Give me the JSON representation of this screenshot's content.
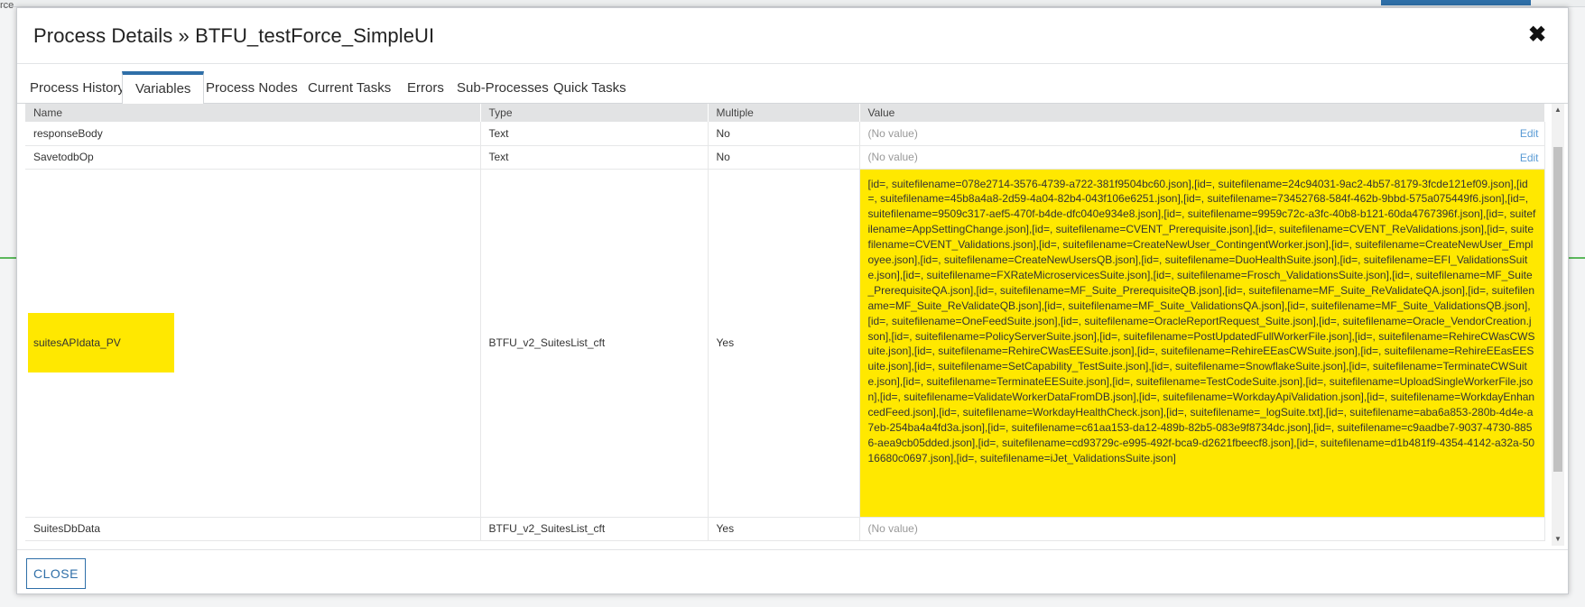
{
  "background": {
    "corner_label": "rce"
  },
  "modal": {
    "title": "Process Details » BTFU_testForce_SimpleUI",
    "close_icon": "close-icon",
    "close_glyph": "✖"
  },
  "tabs": [
    {
      "label": "Process History",
      "active": false
    },
    {
      "label": "Variables",
      "active": true
    },
    {
      "label": "Process Nodes",
      "active": false
    },
    {
      "label": "Current Tasks",
      "active": false
    },
    {
      "label": "Errors",
      "active": false
    },
    {
      "label": "Sub-Processes",
      "active": false
    },
    {
      "label": "Quick Tasks",
      "active": false
    }
  ],
  "table": {
    "headers": {
      "name": "Name",
      "type": "Type",
      "multiple": "Multiple",
      "value": "Value"
    },
    "rows": [
      {
        "name": "responseBody",
        "type": "Text",
        "multiple": "No",
        "value": "(No value)",
        "edit": "Edit"
      },
      {
        "name": "SavetodbOp",
        "type": "Text",
        "multiple": "No",
        "value": "(No value)",
        "edit": "Edit"
      },
      {
        "name": "suitesAPIdata_PV",
        "type": "BTFU_v2_SuitesList_cft",
        "multiple": "Yes",
        "value": "[id=, suitefilename=078e2714-3576-4739-a722-381f9504bc60.json],[id=, suitefilename=24c94031-9ac2-4b57-8179-3fcde121ef09.json],[id=, suitefilename=45b8a4a8-2d59-4a04-82b4-043f106e6251.json],[id=, suitefilename=73452768-584f-462b-9bbd-575a075449f6.json],[id=, suitefilename=9509c317-aef5-470f-b4de-dfc040e934e8.json],[id=, suitefilename=9959c72c-a3fc-40b8-b121-60da4767396f.json],[id=, suitefilename=AppSettingChange.json],[id=, suitefilename=CVENT_Prerequisite.json],[id=, suitefilename=CVENT_ReValidations.json],[id=, suitefilename=CVENT_Validations.json],[id=, suitefilename=CreateNewUser_ContingentWorker.json],[id=, suitefilename=CreateNewUser_Employee.json],[id=, suitefilename=CreateNewUsersQB.json],[id=, suitefilename=DuoHealthSuite.json],[id=, suitefilename=EFI_ValidationsSuite.json],[id=, suitefilename=FXRateMicroservicesSuite.json],[id=, suitefilename=Frosch_ValidationsSuite.json],[id=, suitefilename=MF_Suite_PrerequisiteQA.json],[id=, suitefilename=MF_Suite_PrerequisiteQB.json],[id=, suitefilename=MF_Suite_ReValidateQA.json],[id=, suitefilename=MF_Suite_ReValidateQB.json],[id=, suitefilename=MF_Suite_ValidationsQA.json],[id=, suitefilename=MF_Suite_ValidationsQB.json],[id=, suitefilename=OneFeedSuite.json],[id=, suitefilename=OracleReportRequest_Suite.json],[id=, suitefilename=Oracle_VendorCreation.json],[id=, suitefilename=PolicyServerSuite.json],[id=, suitefilename=PostUpdatedFullWorkerFile.json],[id=, suitefilename=RehireCWasCWSuite.json],[id=, suitefilename=RehireCWasEESuite.json],[id=, suitefilename=RehireEEasCWSuite.json],[id=, suitefilename=RehireEEasEESuite.json],[id=, suitefilename=SetCapability_TestSuite.json],[id=, suitefilename=SnowflakeSuite.json],[id=, suitefilename=TerminateCWSuite.json],[id=, suitefilename=TerminateEESuite.json],[id=, suitefilename=TestCodeSuite.json],[id=, suitefilename=UploadSingleWorkerFile.json],[id=, suitefilename=ValidateWorkerDataFromDB.json],[id=, suitefilename=WorkdayApiValidation.json],[id=, suitefilename=WorkdayEnhancedFeed.json],[id=, suitefilename=WorkdayHealthCheck.json],[id=, suitefilename=_logSuite.txt],[id=, suitefilename=aba6a853-280b-4d4e-a7eb-254ba4a4fd3a.json],[id=, suitefilename=c61aa153-da12-489b-82b5-083e9f8734dc.json],[id=, suitefilename=c9aadbe7-9037-4730-8856-aea9cb05dded.json],[id=, suitefilename=cd93729c-e995-492f-bca9-d2621fbeecf8.json],[id=, suitefilename=d1b481f9-4354-4142-a32a-5016680c0697.json],[id=, suitefilename=iJet_ValidationsSuite.json]"
      },
      {
        "name": "SuitesDbData",
        "type": "BTFU_v2_SuitesList_cft",
        "multiple": "Yes",
        "value": "(No value)"
      }
    ]
  },
  "footer": {
    "close_label": "CLOSE"
  },
  "colors": {
    "accent": "#2f6fa8",
    "highlight": "#ffe800",
    "edit_link": "#5a9bd5"
  }
}
